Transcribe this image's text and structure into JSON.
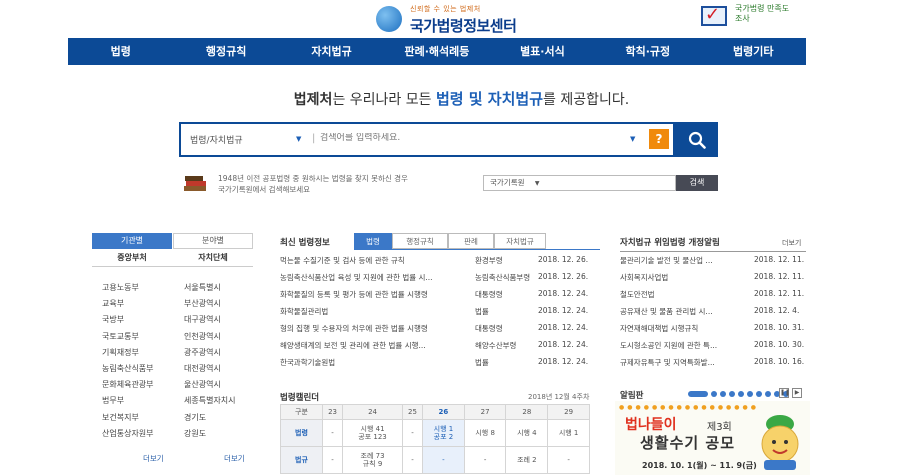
{
  "header": {
    "slogan": "신뢰할 수 있는 법제처",
    "title": "국가법령정보센터",
    "banner_text": "국가법령 만족도 조사"
  },
  "nav": [
    "법령",
    "행정규칙",
    "자치법규",
    "판례·해석례등",
    "별표·서식",
    "학칙·규정",
    "법령기타"
  ],
  "headline": {
    "part1": "법제처",
    "part2": "는 우리나라 모든 ",
    "part3": "법령 및 자치법규",
    "part4": "를 제공합니다."
  },
  "search": {
    "scope": "법령/자치법규",
    "placeholder": "검색어를 입력하세요.",
    "help_label": "?"
  },
  "archive": {
    "desc_line1": "1948년 이전 공포법령 중 원하시는 법령을 찾지 못하신 경우",
    "desc_line2": "국가기록원에서 검색해보세요",
    "select_value": "국가기록원",
    "button_label": "검색"
  },
  "left_panel": {
    "tab_agency": "기관별",
    "tab_field": "분야별",
    "head_central": "중앙부처",
    "head_local": "자치단체",
    "central": [
      "고용노동부",
      "교육부",
      "국방부",
      "국토교통부",
      "기획재정부",
      "농림축산식품부",
      "문화체육관광부",
      "법무부",
      "보건복지부",
      "산업통상자원부"
    ],
    "local": [
      "서울특별시",
      "부산광역시",
      "대구광역시",
      "인천광역시",
      "광주광역시",
      "대전광역시",
      "울산광역시",
      "세종특별자치시",
      "경기도",
      "강원도"
    ],
    "more": "더보기"
  },
  "latest": {
    "title": "최신 법령정보",
    "tabs": [
      "법령",
      "행정규칙",
      "판례",
      "자치법규"
    ],
    "rows": [
      {
        "title": "먹는물 수질기준 및 검사 등에 관한 규칙",
        "agency": "환경부령",
        "date": "2018. 12. 26."
      },
      {
        "title": "농림축산식품산업 육성 및 지원에 관한 법률 시...",
        "agency": "농림축산식품부령",
        "date": "2018. 12. 26."
      },
      {
        "title": "화학물질의 등록 및 평가 등에 관한 법률 시행령",
        "agency": "대통령령",
        "date": "2018. 12. 24."
      },
      {
        "title": "화학물질관리법",
        "agency": "법률",
        "date": "2018. 12. 24."
      },
      {
        "title": "형의 집행 및 수용자의 처우에 관한 법률 시행령",
        "agency": "대통령령",
        "date": "2018. 12. 24."
      },
      {
        "title": "해양생태계의 보전 및 관리에 관한 법률 시행...",
        "agency": "해양수산부령",
        "date": "2018. 12. 24."
      },
      {
        "title": "한국과학기술원법",
        "agency": "법률",
        "date": "2018. 12. 24."
      }
    ]
  },
  "calendar": {
    "title": "법령캘린더",
    "month": "2018년 12월 4주차",
    "header": [
      "구분",
      "23",
      "24",
      "25",
      "26",
      "27",
      "28",
      "29"
    ],
    "rows": [
      {
        "label": "법령",
        "cells": [
          "-",
          "시행 41|공포 123",
          "-",
          "시행 1|공포 2",
          "시행 8",
          "시행 4",
          "시행 1"
        ]
      },
      {
        "label": "법규",
        "cells": [
          "-",
          "조례 73|규칙 9",
          "-",
          "-",
          "-",
          "조례 2",
          "-"
        ]
      }
    ]
  },
  "right_panel": {
    "title": "자치법규 위임법령 개정알림",
    "more": "더보기",
    "rows": [
      {
        "title": "물관리기술 발전 및 물산업 ...",
        "date": "2018. 12. 11."
      },
      {
        "title": "사회복지사업법",
        "date": "2018. 12. 11."
      },
      {
        "title": "철도안전법",
        "date": "2018. 12. 11."
      },
      {
        "title": "공유재산 및 물품 관리법 시...",
        "date": "2018. 12. 4."
      },
      {
        "title": "자연재해대책법 시행규칙",
        "date": "2018. 10. 31."
      },
      {
        "title": "도시형소공인 지원에 관한 특...",
        "date": "2018. 10. 30."
      },
      {
        "title": "규제자유특구 및 지역특화발...",
        "date": "2018. 10. 16."
      }
    ],
    "notice_title": "알림판",
    "promo_title1": "법나들이",
    "promo_round": "제3회",
    "promo_title2": "생활수기 공모",
    "promo_date": "2018. 10. 1(월) ~ 11. 9(금)"
  },
  "colors": {
    "navy": "#0c4a96",
    "accent": "#3b78c8",
    "orange": "#f08a0c"
  }
}
